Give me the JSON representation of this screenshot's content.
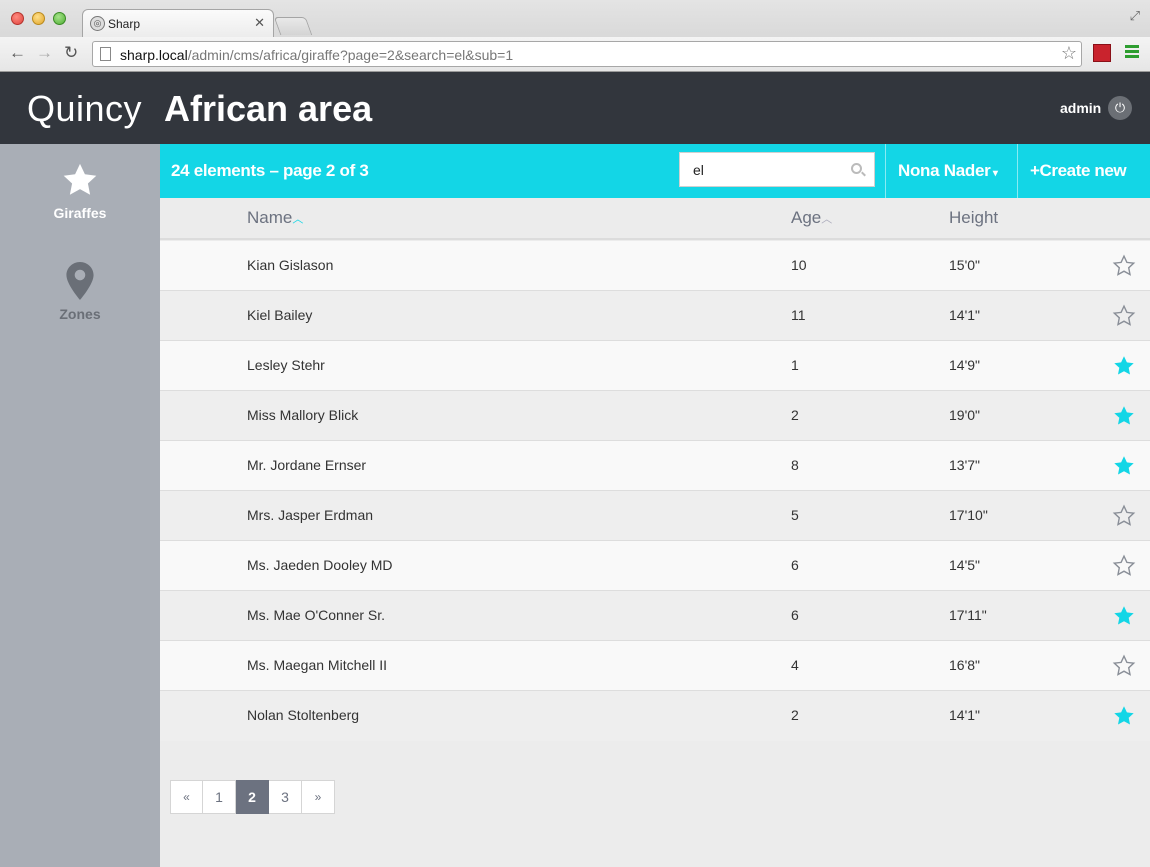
{
  "browser": {
    "tab_title": "Sharp",
    "url_host": "sharp.local",
    "url_path": "/admin/cms/africa/giraffe?page=2&search=el&sub=1"
  },
  "header": {
    "brand": "Quincy",
    "title": "African area",
    "user": "admin"
  },
  "sidebar": {
    "items": [
      {
        "label": "Giraffes",
        "icon": "star-icon",
        "active": true
      },
      {
        "label": "Zones",
        "icon": "map-pin-icon",
        "active": false
      }
    ]
  },
  "listbar": {
    "count_text": "24 elements – page 2 of 3",
    "search_value": "el",
    "dropdown_label": "Nona Nader",
    "create_label": "Create new",
    "accent": "#13d6e6"
  },
  "table": {
    "columns": {
      "name": "Name",
      "age": "Age",
      "height": "Height"
    },
    "rows": [
      {
        "name": "Kian Gislason",
        "age": "10",
        "height": "15'0\"",
        "favorite": false
      },
      {
        "name": "Kiel Bailey",
        "age": "11",
        "height": "14'1\"",
        "favorite": false
      },
      {
        "name": "Lesley Stehr",
        "age": "1",
        "height": "14'9\"",
        "favorite": true
      },
      {
        "name": "Miss Mallory Blick",
        "age": "2",
        "height": "19'0\"",
        "favorite": true
      },
      {
        "name": "Mr. Jordane Ernser",
        "age": "8",
        "height": "13'7\"",
        "favorite": true
      },
      {
        "name": "Mrs. Jasper Erdman",
        "age": "5",
        "height": "17'10\"",
        "favorite": false
      },
      {
        "name": "Ms. Jaeden Dooley MD",
        "age": "6",
        "height": "14'5\"",
        "favorite": false
      },
      {
        "name": "Ms. Mae O'Conner Sr.",
        "age": "6",
        "height": "17'11\"",
        "favorite": true
      },
      {
        "name": "Ms. Maegan Mitchell II",
        "age": "4",
        "height": "16'8\"",
        "favorite": false
      },
      {
        "name": "Nolan Stoltenberg",
        "age": "2",
        "height": "14'1\"",
        "favorite": true
      }
    ]
  },
  "pagination": {
    "prev": "«",
    "pages": [
      "1",
      "2",
      "3"
    ],
    "current": "2",
    "next": "»"
  }
}
